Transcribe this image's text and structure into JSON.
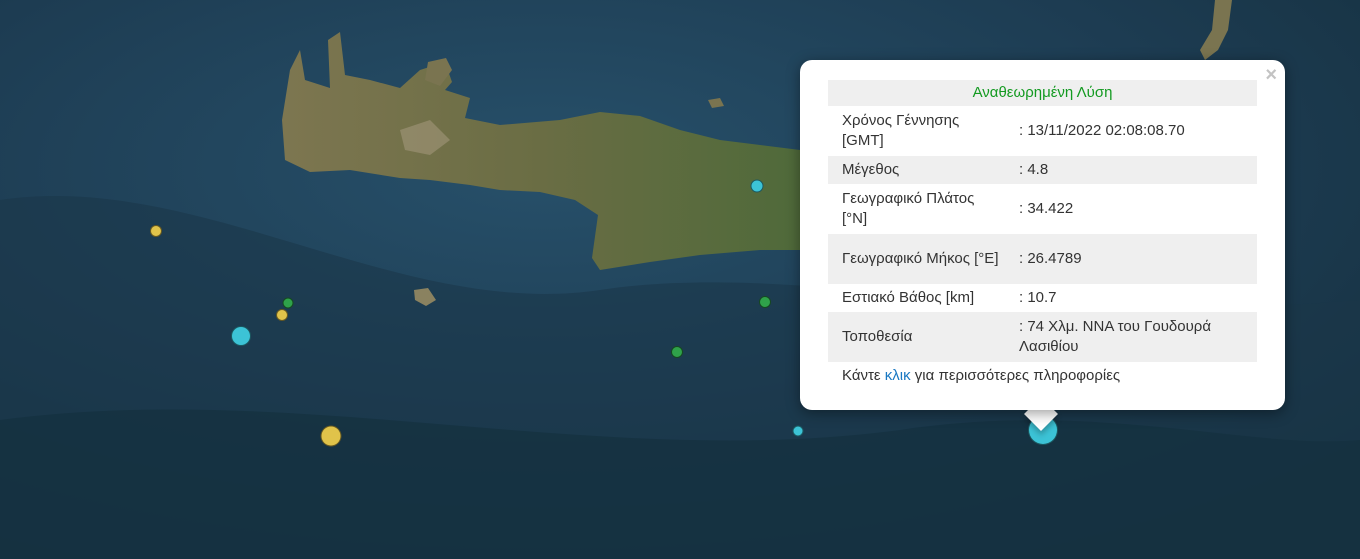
{
  "map": {
    "sea_color": "#1d3c52",
    "land_color": "#6e6a46",
    "markers": [
      {
        "color": "#e0c34a",
        "size": "small"
      },
      {
        "color": "#e0c34a",
        "size": "small"
      },
      {
        "color": "#2fa24a",
        "size": "small"
      },
      {
        "color": "#3cc3d6",
        "size": "medium"
      },
      {
        "color": "#e0c34a",
        "size": "medium"
      },
      {
        "color": "#3cc3d6",
        "size": "small"
      },
      {
        "color": "#2fa24a",
        "size": "small"
      },
      {
        "color": "#2fa24a",
        "size": "small"
      },
      {
        "color": "#3cc3d6",
        "size": "small"
      },
      {
        "color": "#3cc3d6",
        "size": "large"
      }
    ]
  },
  "popup": {
    "close_symbol": "×",
    "title": "Αναθεωρημένη Λύση",
    "rows": [
      {
        "label": "Χρόνος Γέννησης [GMT]",
        "value": ": 13/11/2022 02:08:08.70"
      },
      {
        "label": "Μέγεθος",
        "value": ": 4.8"
      },
      {
        "label": "Γεωγραφικό Πλάτος [°N]",
        "value": ": 34.422"
      },
      {
        "label": "Γεωγραφικό Μήκος [°E]",
        "value": ": 26.4789"
      },
      {
        "label": "Εστιακό Βάθος [km]",
        "value": ": 10.7"
      },
      {
        "label": "Τοποθεσία",
        "value": ": 74 Χλμ. ΝΝΑ του Γουδουρά Λασιθίου"
      }
    ],
    "footer_before": "Κάντε ",
    "footer_link": "κλικ",
    "footer_after": " για περισσότερες πληροφορίες"
  }
}
